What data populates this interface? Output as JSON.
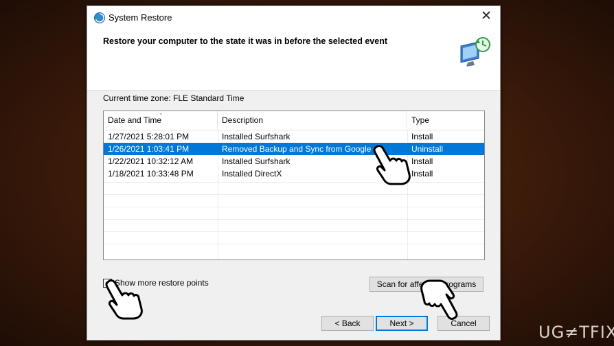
{
  "window": {
    "title": "System Restore",
    "close_glyph": "✕"
  },
  "header": {
    "heading": "Restore your computer to the state it was in before the selected event"
  },
  "timezone_label": "Current time zone: FLE Standard Time",
  "table": {
    "columns": [
      "Date and Time",
      "Description",
      "Type"
    ],
    "sort_indicator": "⌄",
    "rows": [
      {
        "date": "1/27/2021 5:28:01 PM",
        "description": "Installed Surfshark",
        "type": "Install",
        "selected": false
      },
      {
        "date": "1/26/2021 1:03:41 PM",
        "description": "Removed Backup and Sync from Google",
        "type": "Uninstall",
        "selected": true
      },
      {
        "date": "1/22/2021 10:32:12 AM",
        "description": "Installed Surfshark",
        "type": "Install",
        "selected": false
      },
      {
        "date": "1/18/2021 10:33:48 PM",
        "description": "Installed DirectX",
        "type": "Install",
        "selected": false
      }
    ]
  },
  "show_more": {
    "label": "Show more restore points",
    "checked": true,
    "check_glyph": "✓"
  },
  "buttons": {
    "scan": "Scan for affected programs",
    "back": "< Back",
    "next": "Next >",
    "cancel": "Cancel"
  },
  "watermark": "UG≠TFIX",
  "colors": {
    "selection": "#0078d7",
    "background": "#3a1a0a"
  },
  "icons": [
    "system-restore-icon",
    "close-icon",
    "restore-monitor-icon",
    "pointer-hand-icon"
  ]
}
